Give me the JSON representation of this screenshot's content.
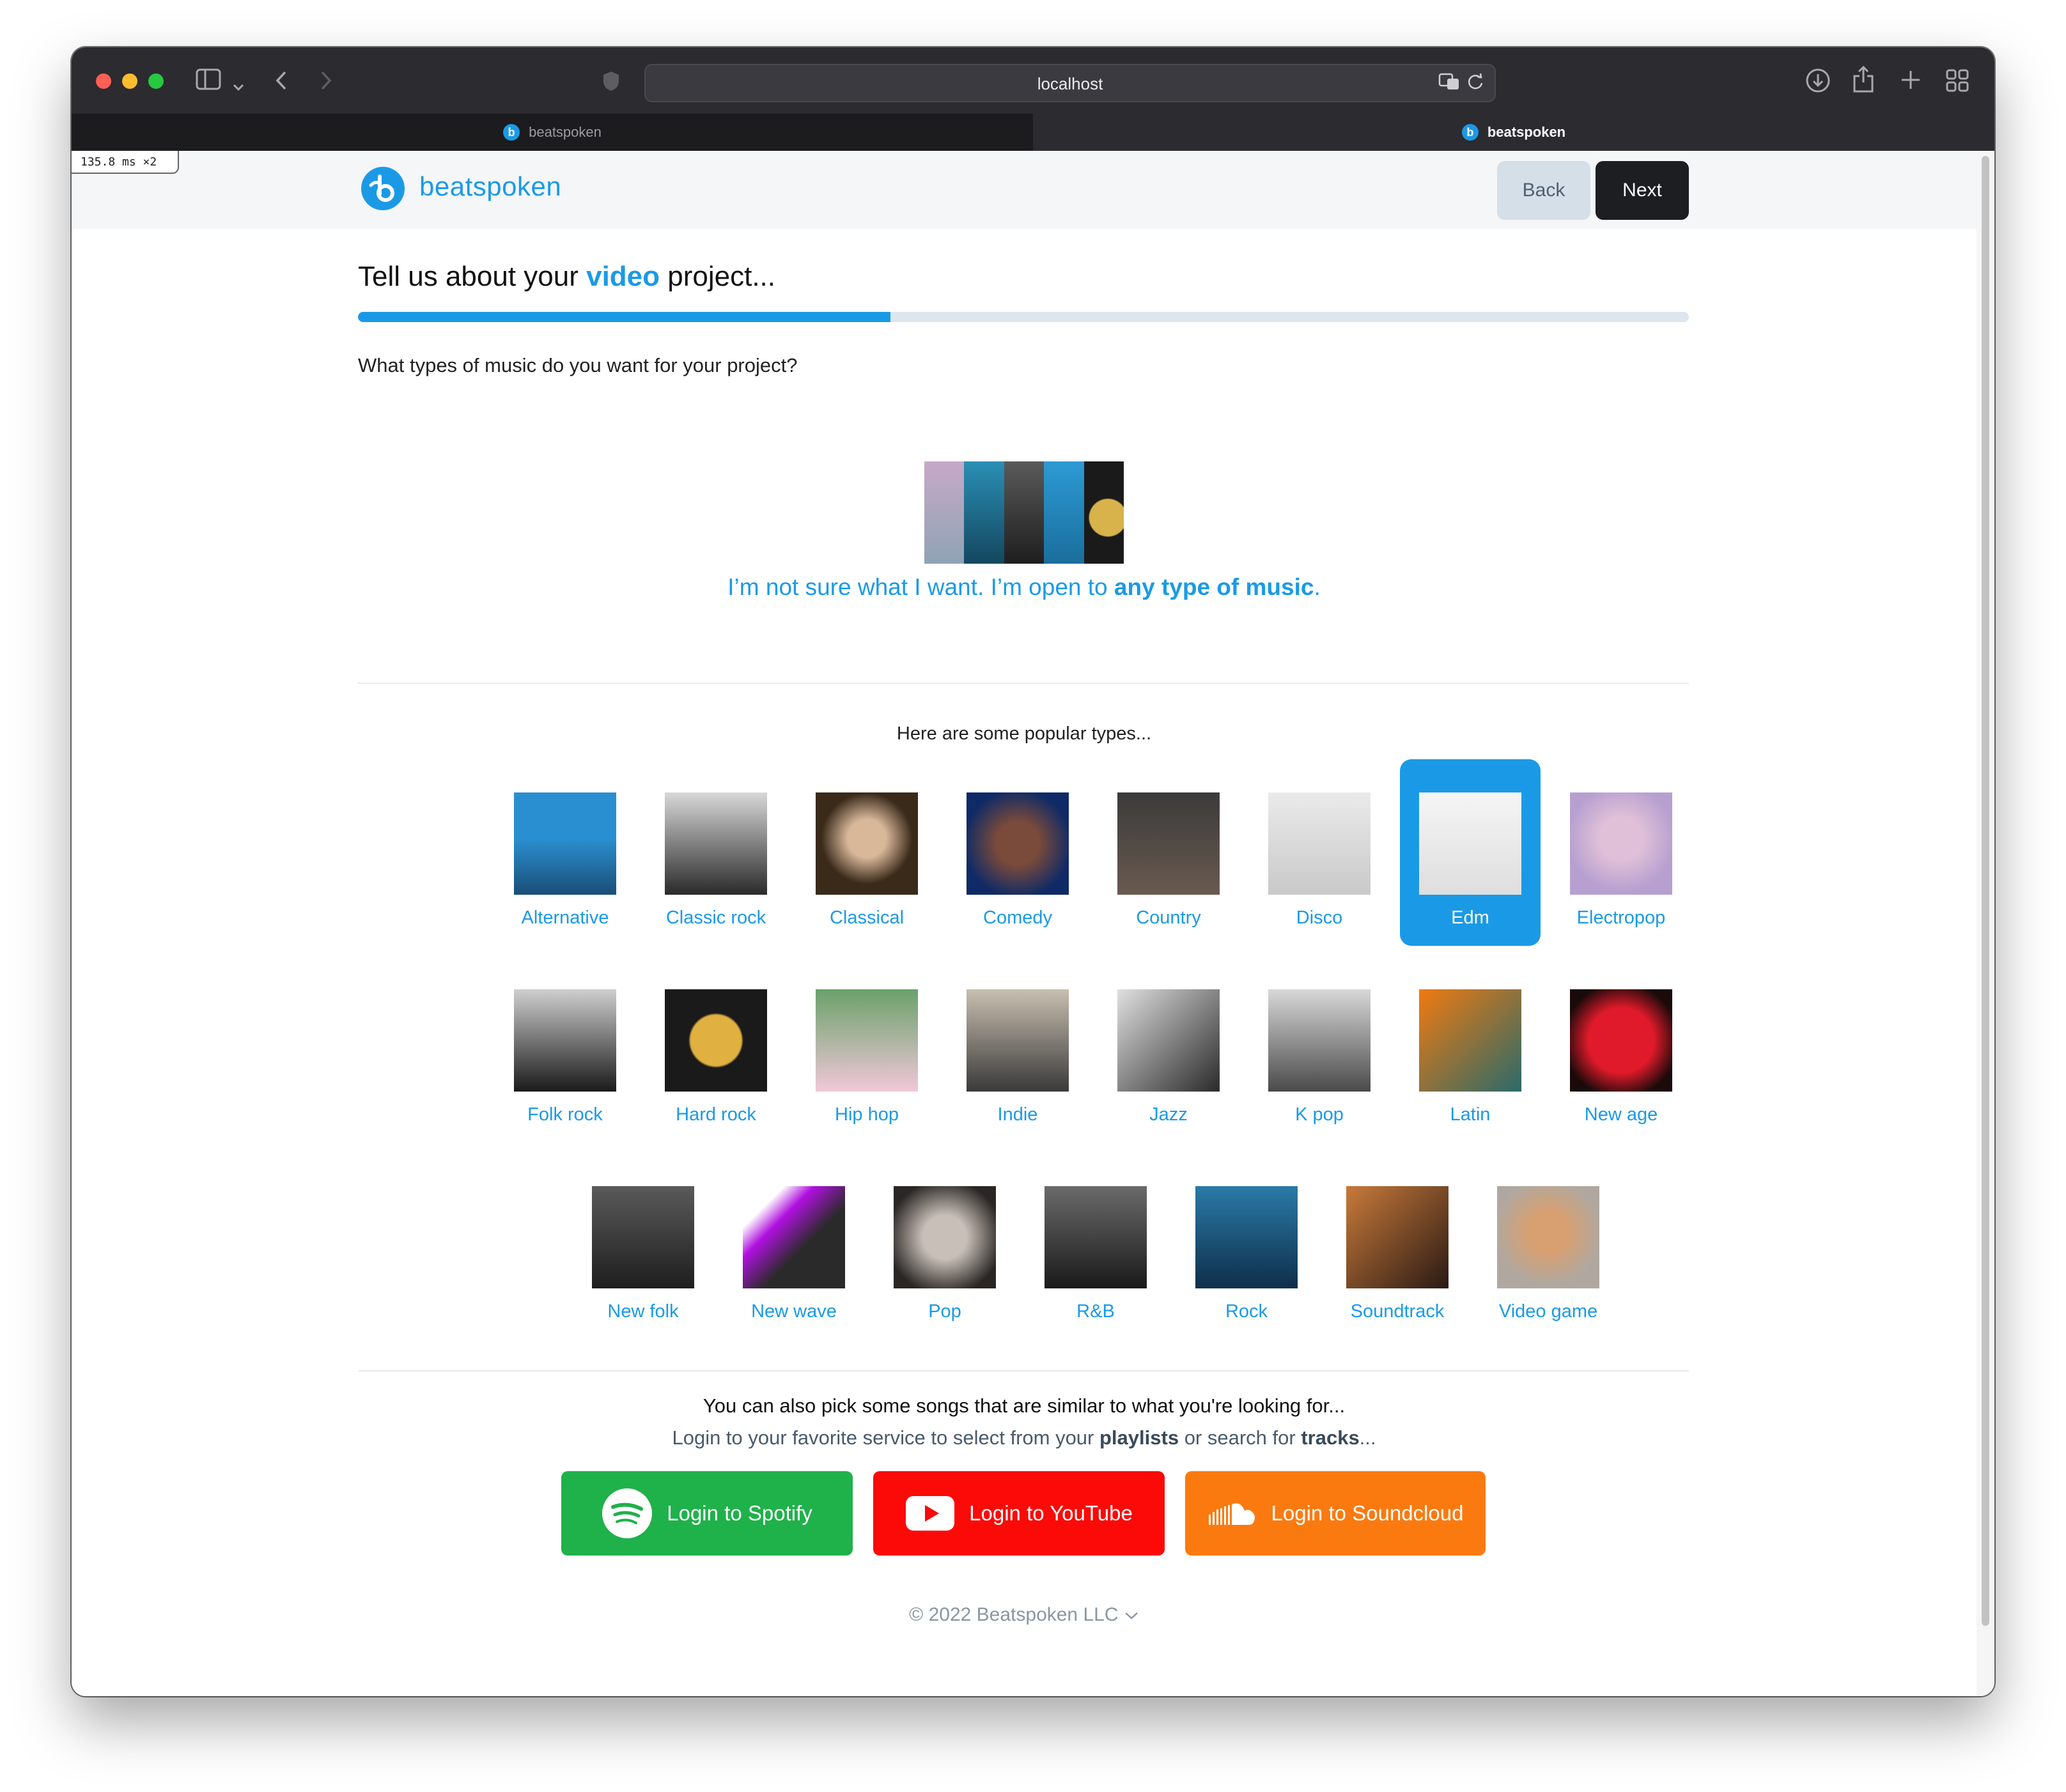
{
  "browser": {
    "url": "localhost",
    "tabs": [
      {
        "label": "beatspoken",
        "active": false
      },
      {
        "label": "beatspoken",
        "active": true
      }
    ],
    "perf_overlay": "135.8 ms ×2"
  },
  "header": {
    "brand": "beatspoken",
    "back_label": "Back",
    "next_label": "Next"
  },
  "form": {
    "heading_prefix": "Tell us about your",
    "heading_accent": "video",
    "heading_suffix": "project...",
    "progress_fraction": 0.4,
    "question": "What types of music do you want for your project?",
    "any_text_prefix": "I’m not sure what I want. I’m open to",
    "any_text_bold": "any type of music",
    "any_text_suffix": ".",
    "popular_label": "Here are some popular types...",
    "genres": [
      {
        "label": "Alternative",
        "selected": false
      },
      {
        "label": "Classic rock",
        "selected": false
      },
      {
        "label": "Classical",
        "selected": false
      },
      {
        "label": "Comedy",
        "selected": false
      },
      {
        "label": "Country",
        "selected": false
      },
      {
        "label": "Disco",
        "selected": false
      },
      {
        "label": "Edm",
        "selected": true
      },
      {
        "label": "Electropop",
        "selected": false
      },
      {
        "label": "Folk rock",
        "selected": false
      },
      {
        "label": "Hard rock",
        "selected": false
      },
      {
        "label": "Hip hop",
        "selected": false
      },
      {
        "label": "Indie",
        "selected": false
      },
      {
        "label": "Jazz",
        "selected": false
      },
      {
        "label": "K pop",
        "selected": false
      },
      {
        "label": "Latin",
        "selected": false
      },
      {
        "label": "New age",
        "selected": false
      },
      {
        "label": "New folk",
        "selected": false
      },
      {
        "label": "New wave",
        "selected": false
      },
      {
        "label": "Pop",
        "selected": false
      },
      {
        "label": "R&B",
        "selected": false
      },
      {
        "label": "Rock",
        "selected": false
      },
      {
        "label": "Soundtrack",
        "selected": false
      },
      {
        "label": "Video game",
        "selected": false
      }
    ],
    "similar_text": "You can also pick some songs that are similar to what you're looking for...",
    "login_prefix": "Login to your favorite service to select from your",
    "login_playlists": "playlists",
    "login_middle": "or search for",
    "login_tracks": "tracks",
    "login_suffix": "...",
    "services": {
      "spotify": "Login to Spotify",
      "youtube": "Login to YouTube",
      "soundcloud": "Login to Soundcloud"
    }
  },
  "footer": {
    "copyright": "© 2022 Beatspoken LLC"
  },
  "colors": {
    "accent": "#1a9ae6",
    "spotify": "#1fb14a",
    "youtube": "#fb0a08",
    "soundcloud": "#fb7a10",
    "next_button": "#1d1e22",
    "back_button": "#d5dfe8"
  }
}
